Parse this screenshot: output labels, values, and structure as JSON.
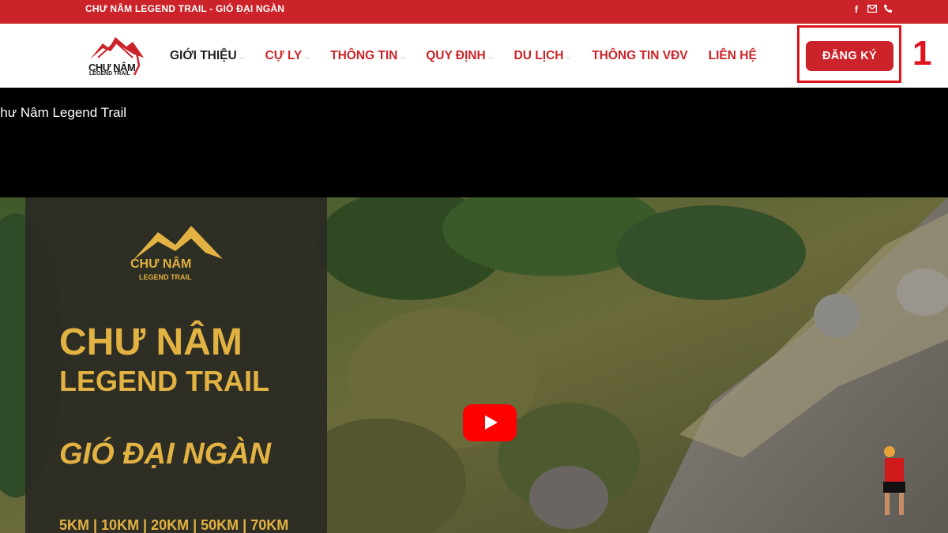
{
  "topbar": {
    "title": "CHƯ NÂM LEGEND TRAIL - GIÓ ĐẠI NGÀN",
    "icons": [
      "facebook-icon",
      "email-icon",
      "phone-icon"
    ]
  },
  "logo": {
    "line1": "CHƯ NÂM",
    "line2": "LEGEND TRAIL"
  },
  "nav": {
    "items": [
      {
        "label": "GIỚI THIỆU",
        "dropdown": true
      },
      {
        "label": "CỰ LY",
        "dropdown": true
      },
      {
        "label": "THÔNG TIN",
        "dropdown": true
      },
      {
        "label": "QUY ĐỊNH",
        "dropdown": true
      },
      {
        "label": "DU LỊCH",
        "dropdown": true
      },
      {
        "label": "THÔNG TIN VĐV",
        "dropdown": false
      },
      {
        "label": "LIÊN HỆ",
        "dropdown": false
      }
    ],
    "register_label": "ĐĂNG KÝ",
    "chevron": "⌵"
  },
  "annotation": {
    "step": "1"
  },
  "video": {
    "title": "Chư Nâm Legend Trail",
    "poster": {
      "logo_line1": "CHƯ NÂM",
      "logo_line2": "LEGEND TRAIL",
      "heading_line1": "CHƯ NÂM",
      "heading_line2": "LEGEND TRAIL",
      "tagline": "GIÓ ĐẠI NGÀN",
      "distances": "5KM | 10KM | 20KM | 50KM | 70KM"
    }
  },
  "colors": {
    "brand_red": "#cb2329",
    "highlight_red": "#e0141e",
    "poster_gold": "#e2b242",
    "youtube_red": "#ff0000"
  }
}
